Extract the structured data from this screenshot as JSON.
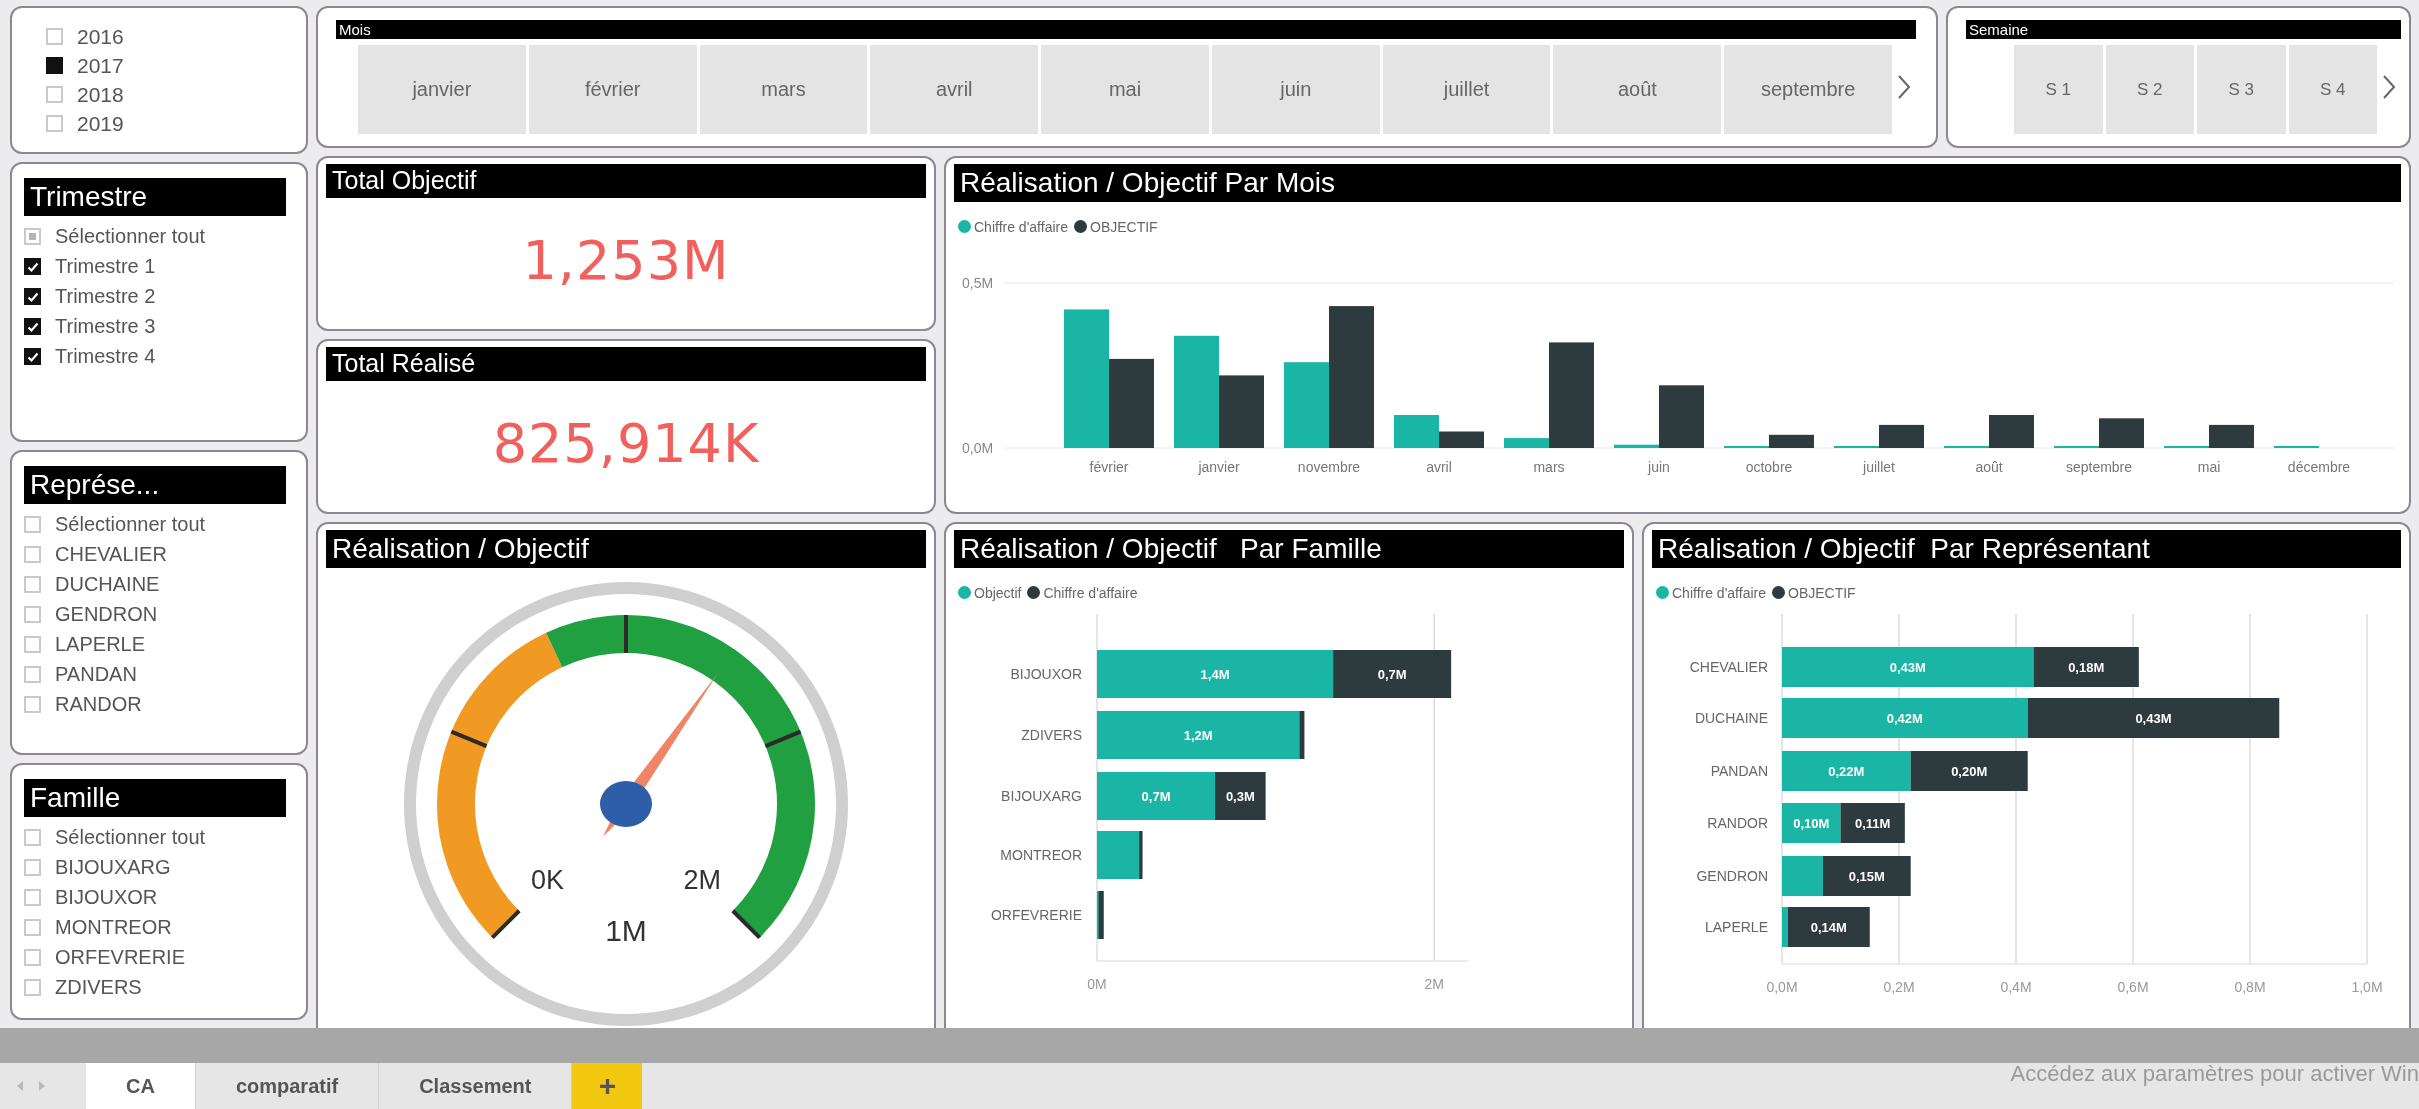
{
  "year_slicer": {
    "items": [
      {
        "label": "2016",
        "checked": false
      },
      {
        "label": "2017",
        "checked": true
      },
      {
        "label": "2018",
        "checked": false
      },
      {
        "label": "2019",
        "checked": false
      }
    ]
  },
  "month_slicer": {
    "title": "Mois",
    "items": [
      {
        "label": "janvier",
        "selected": false
      },
      {
        "label": "février",
        "selected": false
      },
      {
        "label": "mars",
        "selected": false
      },
      {
        "label": "avril",
        "selected": false
      },
      {
        "label": "mai",
        "selected": false
      },
      {
        "label": "juin",
        "selected": false
      },
      {
        "label": "juillet",
        "selected": false
      },
      {
        "label": "août",
        "selected": false
      },
      {
        "label": "septembre",
        "selected": false
      }
    ]
  },
  "week_slicer": {
    "title": "Semaine",
    "items": [
      {
        "label": "S 1",
        "selected": false
      },
      {
        "label": "S 2",
        "selected": false
      },
      {
        "label": "S 3",
        "selected": false
      },
      {
        "label": "S 4",
        "selected": false
      }
    ]
  },
  "filters": [
    {
      "title": "Trimestre",
      "items": [
        {
          "label": "Sélectionner tout",
          "checked": false,
          "indeterminate": true
        },
        {
          "label": "Trimestre 1",
          "checked": true
        },
        {
          "label": "Trimestre 2",
          "checked": true
        },
        {
          "label": "Trimestre 3",
          "checked": true
        },
        {
          "label": "Trimestre 4",
          "checked": true
        }
      ]
    },
    {
      "title": "Représe...",
      "items": [
        {
          "label": "Sélectionner tout",
          "checked": false
        },
        {
          "label": "CHEVALIER",
          "checked": false
        },
        {
          "label": "DUCHAINE",
          "checked": false
        },
        {
          "label": "GENDRON",
          "checked": false
        },
        {
          "label": "LAPERLE",
          "checked": false
        },
        {
          "label": "PANDAN",
          "checked": false
        },
        {
          "label": "RANDOR",
          "checked": false
        }
      ]
    },
    {
      "title": "Famille",
      "items": [
        {
          "label": "Sélectionner tout",
          "checked": false
        },
        {
          "label": "BIJOUXARG",
          "checked": false
        },
        {
          "label": "BIJOUXOR",
          "checked": false
        },
        {
          "label": "MONTREOR",
          "checked": false
        },
        {
          "label": "ORFEVRERIE",
          "checked": false
        },
        {
          "label": "ZDIVERS",
          "checked": false
        }
      ]
    }
  ],
  "kpis": [
    {
      "title": "Total Objectif",
      "value": "1,253M"
    },
    {
      "title": "Total Réalisé",
      "value": "825,914K"
    }
  ],
  "month_chart": {
    "title": "Réalisation / Objectif Par Mois",
    "chart_data": {
      "type": "bar",
      "categories": [
        "février",
        "janvier",
        "novembre",
        "avril",
        "mars",
        "juin",
        "octobre",
        "juillet",
        "août",
        "septembre",
        "mai",
        "décembre"
      ],
      "series": [
        {
          "name": "Chiffre d'affaire",
          "color": "#1ab5a4",
          "values": [
            0.42,
            0.34,
            0.26,
            0.1,
            0.03,
            0.01,
            0.003,
            0.003,
            0.003,
            0.003,
            0.003,
            0.003
          ]
        },
        {
          "name": "OBJECTIF",
          "color": "#2d3b3e",
          "values": [
            0.27,
            0.22,
            0.43,
            0.05,
            0.32,
            0.19,
            0.04,
            0.07,
            0.1,
            0.09,
            0.07,
            null
          ]
        }
      ],
      "ylim": [
        0,
        0.5
      ],
      "grid": true,
      "yticks": [
        {
          "value": 0,
          "label": "0,0M"
        },
        {
          "value": 0.5,
          "label": "0,5M"
        }
      ]
    }
  },
  "gauge": {
    "title": "Réalisation / Objectif",
    "min_label": "0K",
    "max_label": "2M",
    "mid_label": "1M",
    "level": 0.63
  },
  "family_chart": {
    "title": "Réalisation / Objectif   Par Famille",
    "chart_data": {
      "type": "bar",
      "orientation": "horizontal",
      "stacked": true,
      "categories": [
        "BIJOUXOR",
        "ZDIVERS",
        "BIJOUXARG",
        "MONTREOR",
        "ORFEVRERIE"
      ],
      "series": [
        {
          "name": "Objectif",
          "color": "#1ab5a4",
          "values": [
            1.4,
            1.2,
            0.7,
            0.25,
            0.01
          ]
        },
        {
          "name": "Chiffre d'affaire",
          "color": "#2d3b3e",
          "values": [
            0.7,
            0.03,
            0.3,
            0.02,
            0.03
          ]
        }
      ],
      "xlim": [
        0,
        2.2
      ],
      "grid": true,
      "xticks": [
        {
          "value": 0,
          "label": "0M"
        },
        {
          "value": 2,
          "label": "2M"
        }
      ],
      "value_labels": [
        [
          "1,4M",
          "1,2M",
          "0,7M",
          null,
          null
        ],
        [
          "0,7M",
          null,
          "0,3M",
          null,
          null
        ]
      ]
    }
  },
  "rep_chart": {
    "title": "Réalisation / Objectif  Par Représentant",
    "chart_data": {
      "type": "bar",
      "orientation": "horizontal",
      "stacked": true,
      "categories": [
        "CHEVALIER",
        "DUCHAINE",
        "PANDAN",
        "RANDOR",
        "GENDRON",
        "LAPERLE"
      ],
      "series": [
        {
          "name": "Chiffre d'affaire",
          "color": "#1ab5a4",
          "values": [
            0.43,
            0.42,
            0.22,
            0.1,
            0.07,
            0.01
          ]
        },
        {
          "name": "OBJECTIF",
          "color": "#2d3b3e",
          "values": [
            0.18,
            0.43,
            0.2,
            0.11,
            0.15,
            0.14
          ]
        }
      ],
      "xlim": [
        0,
        1
      ],
      "grid": true,
      "xticks": [
        {
          "value": 0,
          "label": "0,0M"
        },
        {
          "value": 0.2,
          "label": "0,2M"
        },
        {
          "value": 0.4,
          "label": "0,4M"
        },
        {
          "value": 0.6,
          "label": "0,6M"
        },
        {
          "value": 0.8,
          "label": "0,8M"
        },
        {
          "value": 1,
          "label": "1,0M"
        }
      ],
      "value_labels": [
        [
          "0,43M",
          "0,42M",
          "0,22M",
          "0,10M",
          null,
          null
        ],
        [
          "0,18M",
          "0,43M",
          "0,20M",
          "0,11M",
          "0,15M",
          "0,14M"
        ]
      ]
    }
  },
  "tabs": [
    {
      "label": "CA",
      "selected": true
    },
    {
      "label": "comparatif",
      "selected": false
    },
    {
      "label": "Classement",
      "selected": false
    }
  ],
  "add_tab": "+",
  "system_notice": "Accédez aux paramètres pour activer Win"
}
